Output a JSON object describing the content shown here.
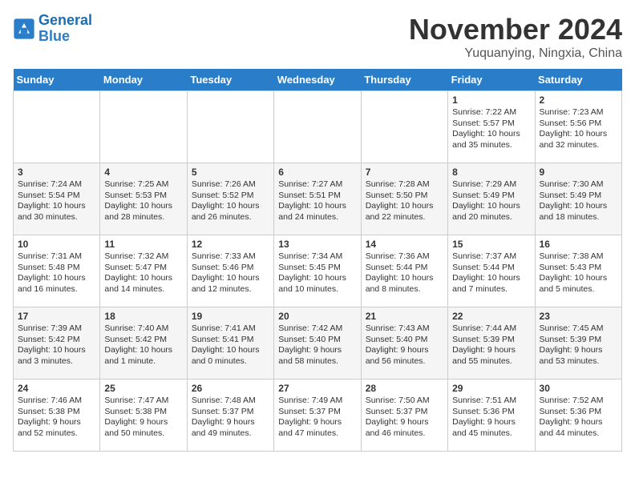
{
  "header": {
    "logo_line1": "General",
    "logo_line2": "Blue",
    "month_title": "November 2024",
    "location": "Yuquanying, Ningxia, China"
  },
  "weekdays": [
    "Sunday",
    "Monday",
    "Tuesday",
    "Wednesday",
    "Thursday",
    "Friday",
    "Saturday"
  ],
  "weeks": [
    [
      {
        "day": "",
        "content": ""
      },
      {
        "day": "",
        "content": ""
      },
      {
        "day": "",
        "content": ""
      },
      {
        "day": "",
        "content": ""
      },
      {
        "day": "",
        "content": ""
      },
      {
        "day": "1",
        "content": "Sunrise: 7:22 AM\nSunset: 5:57 PM\nDaylight: 10 hours and 35 minutes."
      },
      {
        "day": "2",
        "content": "Sunrise: 7:23 AM\nSunset: 5:56 PM\nDaylight: 10 hours and 32 minutes."
      }
    ],
    [
      {
        "day": "3",
        "content": "Sunrise: 7:24 AM\nSunset: 5:54 PM\nDaylight: 10 hours and 30 minutes."
      },
      {
        "day": "4",
        "content": "Sunrise: 7:25 AM\nSunset: 5:53 PM\nDaylight: 10 hours and 28 minutes."
      },
      {
        "day": "5",
        "content": "Sunrise: 7:26 AM\nSunset: 5:52 PM\nDaylight: 10 hours and 26 minutes."
      },
      {
        "day": "6",
        "content": "Sunrise: 7:27 AM\nSunset: 5:51 PM\nDaylight: 10 hours and 24 minutes."
      },
      {
        "day": "7",
        "content": "Sunrise: 7:28 AM\nSunset: 5:50 PM\nDaylight: 10 hours and 22 minutes."
      },
      {
        "day": "8",
        "content": "Sunrise: 7:29 AM\nSunset: 5:49 PM\nDaylight: 10 hours and 20 minutes."
      },
      {
        "day": "9",
        "content": "Sunrise: 7:30 AM\nSunset: 5:49 PM\nDaylight: 10 hours and 18 minutes."
      }
    ],
    [
      {
        "day": "10",
        "content": "Sunrise: 7:31 AM\nSunset: 5:48 PM\nDaylight: 10 hours and 16 minutes."
      },
      {
        "day": "11",
        "content": "Sunrise: 7:32 AM\nSunset: 5:47 PM\nDaylight: 10 hours and 14 minutes."
      },
      {
        "day": "12",
        "content": "Sunrise: 7:33 AM\nSunset: 5:46 PM\nDaylight: 10 hours and 12 minutes."
      },
      {
        "day": "13",
        "content": "Sunrise: 7:34 AM\nSunset: 5:45 PM\nDaylight: 10 hours and 10 minutes."
      },
      {
        "day": "14",
        "content": "Sunrise: 7:36 AM\nSunset: 5:44 PM\nDaylight: 10 hours and 8 minutes."
      },
      {
        "day": "15",
        "content": "Sunrise: 7:37 AM\nSunset: 5:44 PM\nDaylight: 10 hours and 7 minutes."
      },
      {
        "day": "16",
        "content": "Sunrise: 7:38 AM\nSunset: 5:43 PM\nDaylight: 10 hours and 5 minutes."
      }
    ],
    [
      {
        "day": "17",
        "content": "Sunrise: 7:39 AM\nSunset: 5:42 PM\nDaylight: 10 hours and 3 minutes."
      },
      {
        "day": "18",
        "content": "Sunrise: 7:40 AM\nSunset: 5:42 PM\nDaylight: 10 hours and 1 minute."
      },
      {
        "day": "19",
        "content": "Sunrise: 7:41 AM\nSunset: 5:41 PM\nDaylight: 10 hours and 0 minutes."
      },
      {
        "day": "20",
        "content": "Sunrise: 7:42 AM\nSunset: 5:40 PM\nDaylight: 9 hours and 58 minutes."
      },
      {
        "day": "21",
        "content": "Sunrise: 7:43 AM\nSunset: 5:40 PM\nDaylight: 9 hours and 56 minutes."
      },
      {
        "day": "22",
        "content": "Sunrise: 7:44 AM\nSunset: 5:39 PM\nDaylight: 9 hours and 55 minutes."
      },
      {
        "day": "23",
        "content": "Sunrise: 7:45 AM\nSunset: 5:39 PM\nDaylight: 9 hours and 53 minutes."
      }
    ],
    [
      {
        "day": "24",
        "content": "Sunrise: 7:46 AM\nSunset: 5:38 PM\nDaylight: 9 hours and 52 minutes."
      },
      {
        "day": "25",
        "content": "Sunrise: 7:47 AM\nSunset: 5:38 PM\nDaylight: 9 hours and 50 minutes."
      },
      {
        "day": "26",
        "content": "Sunrise: 7:48 AM\nSunset: 5:37 PM\nDaylight: 9 hours and 49 minutes."
      },
      {
        "day": "27",
        "content": "Sunrise: 7:49 AM\nSunset: 5:37 PM\nDaylight: 9 hours and 47 minutes."
      },
      {
        "day": "28",
        "content": "Sunrise: 7:50 AM\nSunset: 5:37 PM\nDaylight: 9 hours and 46 minutes."
      },
      {
        "day": "29",
        "content": "Sunrise: 7:51 AM\nSunset: 5:36 PM\nDaylight: 9 hours and 45 minutes."
      },
      {
        "day": "30",
        "content": "Sunrise: 7:52 AM\nSunset: 5:36 PM\nDaylight: 9 hours and 44 minutes."
      }
    ]
  ]
}
